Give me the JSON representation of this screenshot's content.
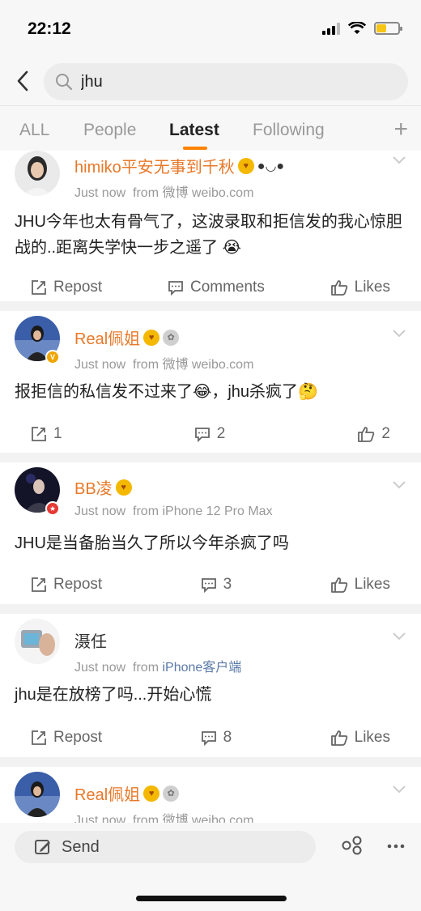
{
  "status": {
    "time": "22:12"
  },
  "search": {
    "value": "jhu"
  },
  "tabs": [
    "ALL",
    "People",
    "Latest",
    "Following"
  ],
  "active_tab": "Latest",
  "posts": [
    {
      "username": "himiko平安无事到千秋",
      "time": "Just now",
      "source_prefix": "from",
      "source": "微博 weibo.com",
      "text": "JHU今年也太有骨气了，这波录取和拒信发的我心惊胆战的..距离失学快一步之遥了 😭",
      "repost": "Repost",
      "comments": "Comments",
      "likes": "Likes"
    },
    {
      "username": "Real佩姐",
      "time": "Just now",
      "source_prefix": "from",
      "source": "微博 weibo.com",
      "text": "报拒信的私信发不过来了😂，jhu杀疯了🤔",
      "repost": "1",
      "comments": "2",
      "likes": "2"
    },
    {
      "username": "BB凌",
      "time": "Just now",
      "source_prefix": "from",
      "source": "iPhone 12 Pro Max",
      "text": "JHU是当备胎当久了所以今年杀疯了吗",
      "repost": "Repost",
      "comments": "3",
      "likes": "Likes"
    },
    {
      "username": "滠任",
      "time": "Just now",
      "source_prefix": "from",
      "source": "iPhone客户端",
      "text": "jhu是在放榜了吗...开始心慌",
      "repost": "Repost",
      "comments": "8",
      "likes": "Likes"
    },
    {
      "username": "Real佩姐",
      "time": "Just now",
      "source_prefix": "from",
      "source": "微博 weibo.com"
    }
  ],
  "bottom": {
    "send_label": "Send"
  },
  "colors": {
    "accent": "#ff8200",
    "username": "#e8792a",
    "source_link": "#5b7aa8"
  }
}
